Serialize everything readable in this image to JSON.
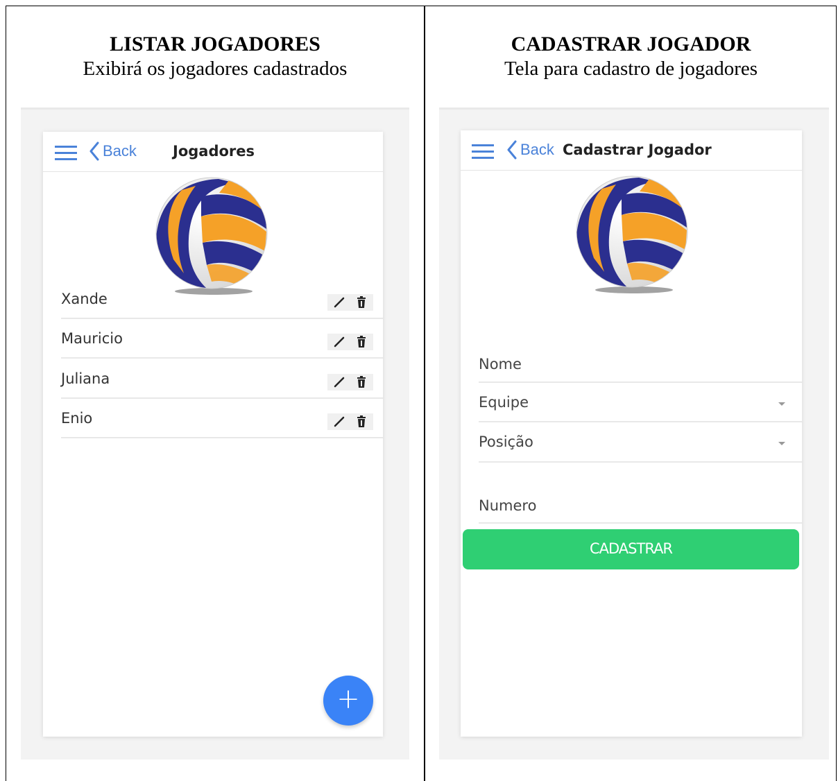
{
  "left": {
    "title": "LISTAR JOGADORES",
    "subtitle": "Exibirá os jogadores cadastrados",
    "nav": {
      "back_label": "Back",
      "title": "Jogadores"
    },
    "players": [
      {
        "name": "Xande"
      },
      {
        "name": "Mauricio"
      },
      {
        "name": "Juliana"
      },
      {
        "name": "Enio"
      }
    ],
    "fab_label": "+"
  },
  "right": {
    "title": "CADASTRAR JOGADOR",
    "subtitle": "Tela para cadastro de jogadores",
    "nav": {
      "back_label": "Back",
      "title": "Cadastrar Jogador"
    },
    "form": {
      "nome_label": "Nome",
      "equipe_label": "Equipe",
      "posicao_label": "Posição",
      "numero_label": "Numero",
      "submit_label": "CADASTRAR"
    }
  },
  "colors": {
    "accent": "#4a82d9",
    "fab": "#3a83f7",
    "submit": "#2fcf73",
    "ball_orange": "#f5a128",
    "ball_blue": "#2b2f8f"
  },
  "icons": [
    "menu-icon",
    "chevron-left-icon",
    "volleyball-icon",
    "pencil-icon",
    "trash-icon",
    "plus-icon",
    "dropdown-caret-icon"
  ]
}
